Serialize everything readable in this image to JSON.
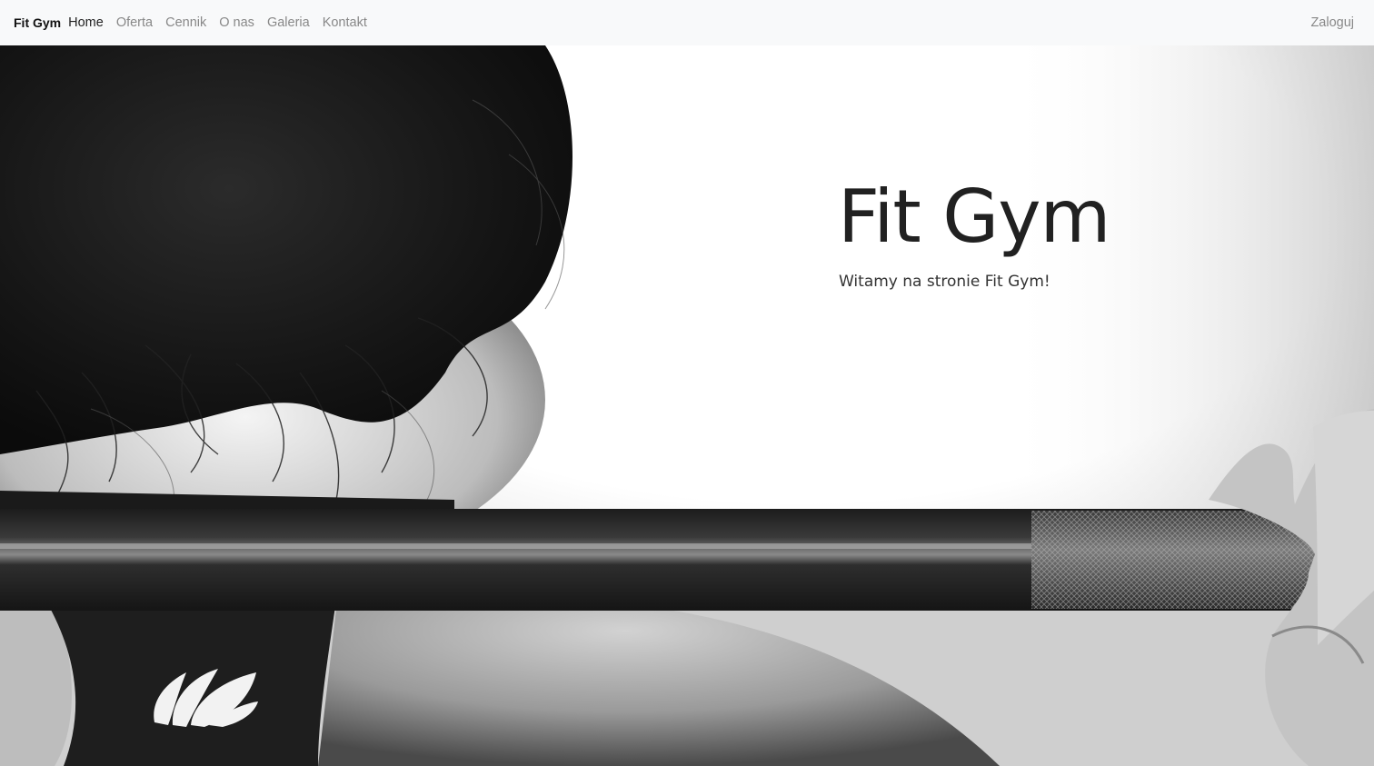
{
  "navbar": {
    "brand": "Fit Gym",
    "links": [
      {
        "label": "Home",
        "active": true
      },
      {
        "label": "Oferta",
        "active": false
      },
      {
        "label": "Cennik",
        "active": false
      },
      {
        "label": "O nas",
        "active": false
      },
      {
        "label": "Galeria",
        "active": false
      },
      {
        "label": "Kontakt",
        "active": false
      }
    ],
    "login_label": "Zaloguj"
  },
  "hero": {
    "title": "Fit Gym",
    "subtitle": "Witamy na stronie Fit Gym!"
  },
  "colors": {
    "navbar_bg": "#f8f9fa",
    "link_muted": "#888888",
    "link_active": "#222222"
  }
}
